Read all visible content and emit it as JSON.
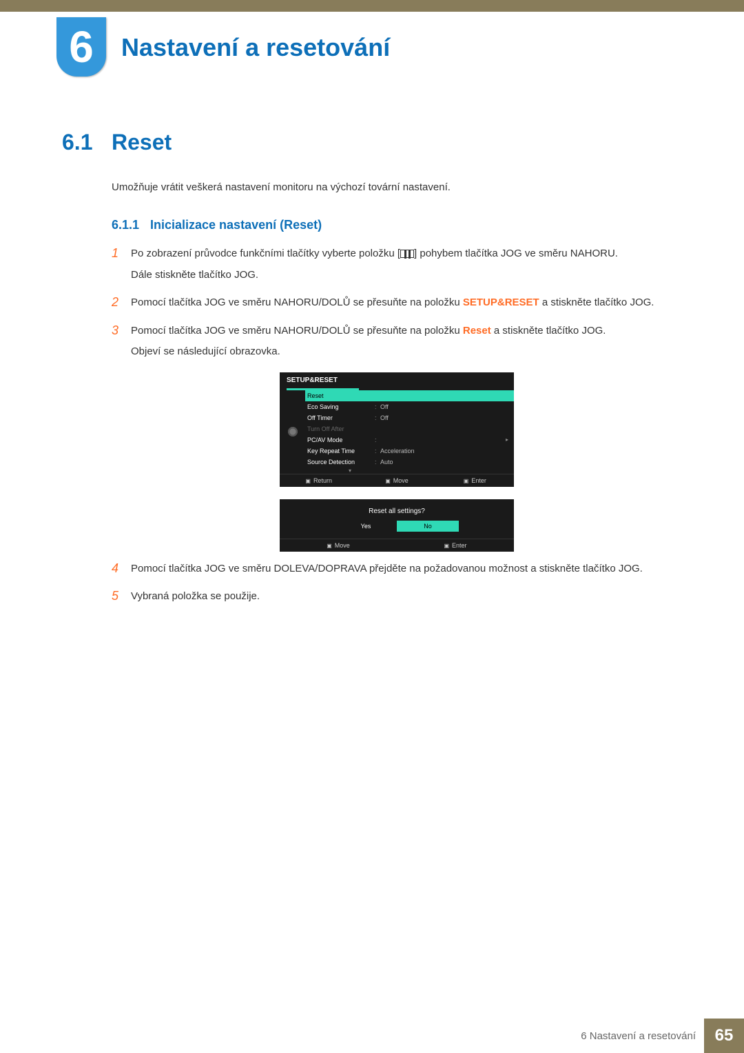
{
  "chapter": {
    "number": "6",
    "title": "Nastavení a resetování"
  },
  "section": {
    "number": "6.1",
    "title": "Reset"
  },
  "intro": "Umožňuje vrátit veškerá nastavení monitoru na výchozí tovární nastavení.",
  "subsection": {
    "number": "6.1.1",
    "title": "Inicializace nastavení (Reset)"
  },
  "steps": {
    "s1": {
      "num": "1",
      "p1a": "Po zobrazení průvodce funkčními tlačítky vyberte položku [",
      "p1b": "] pohybem tlačítka JOG ve směru NAHORU.",
      "p2": "Dále stiskněte tlačítko JOG."
    },
    "s2": {
      "num": "2",
      "p1a": "Pomocí tlačítka JOG ve směru NAHORU/DOLŮ se přesuňte na položku ",
      "kw": "SETUP&RESET",
      "p1b": " a stiskněte tlačítko JOG."
    },
    "s3": {
      "num": "3",
      "p1a": "Pomocí tlačítka JOG ve směru NAHORU/DOLŮ se přesuňte na položku ",
      "kw": "Reset",
      "p1b": " a stiskněte tlačítko JOG.",
      "p2": "Objeví se následující obrazovka."
    },
    "s4": {
      "num": "4",
      "p1": "Pomocí tlačítka JOG ve směru DOLEVA/DOPRAVA přejděte na požadovanou možnost a stiskněte tlačítko JOG."
    },
    "s5": {
      "num": "5",
      "p1": "Vybraná položka se použije."
    }
  },
  "osd": {
    "title": "SETUP&RESET",
    "rows": {
      "reset": "Reset",
      "eco": "Eco Saving",
      "eco_v": "Off",
      "offtimer": "Off Timer",
      "offtimer_v": "Off",
      "turnoff": "Turn Off After",
      "pcav": "PC/AV Mode",
      "keyrep": "Key Repeat Time",
      "keyrep_v": "Acceleration",
      "srcdet": "Source Detection",
      "srcdet_v": "Auto"
    },
    "footer": {
      "return": "Return",
      "move": "Move",
      "enter": "Enter"
    }
  },
  "osd2": {
    "question": "Reset all settings?",
    "yes": "Yes",
    "no": "No",
    "footer": {
      "move": "Move",
      "enter": "Enter"
    }
  },
  "footer": {
    "chapter_ref": "6 Nastavení a resetování",
    "page": "65"
  }
}
